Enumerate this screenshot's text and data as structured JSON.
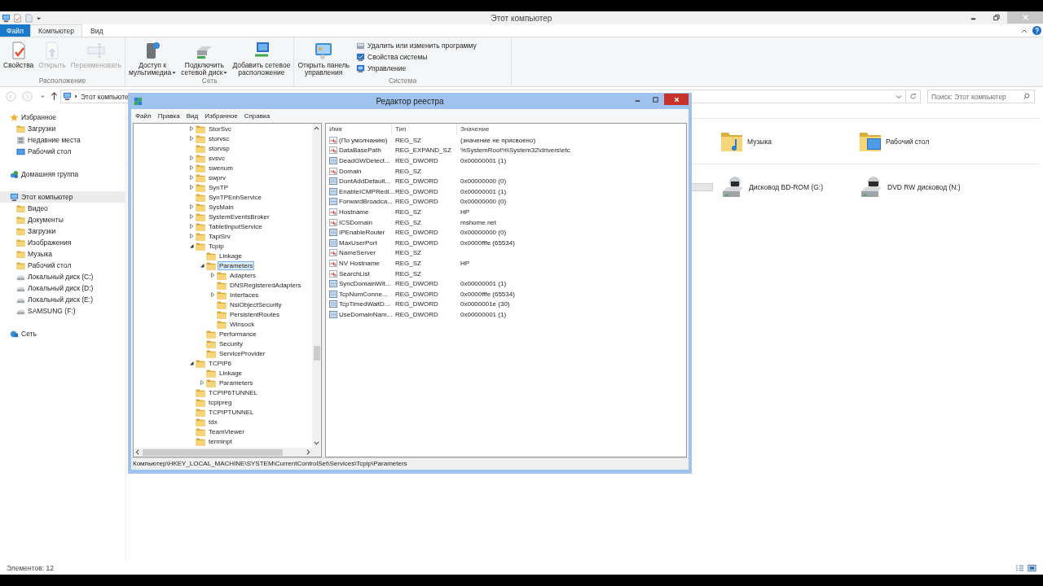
{
  "explorer": {
    "title": "Этот компьютер",
    "file_button": "Файл",
    "tabs": [
      {
        "label": "Компьютер",
        "selected": true
      },
      {
        "label": "Вид",
        "selected": false
      }
    ],
    "ribbon_groups": [
      {
        "label": "Расположение",
        "buttons": [
          {
            "label": "Свойства",
            "disabled": false,
            "dropdown": false
          },
          {
            "label": "Открыть",
            "disabled": true,
            "dropdown": false
          },
          {
            "label": "Переименовать",
            "disabled": true,
            "dropdown": false
          }
        ]
      },
      {
        "label": "Сеть",
        "buttons": [
          {
            "label": "Доступ к\nмультимедиа",
            "disabled": false,
            "dropdown": true
          },
          {
            "label": "Подключить\nсетевой диск",
            "disabled": false,
            "dropdown": true
          },
          {
            "label": "Добавить сетевое\nрасположение",
            "disabled": false,
            "dropdown": false
          }
        ]
      },
      {
        "label": "Система",
        "buttons": [
          {
            "label": "Открыть панель\nуправления",
            "disabled": false,
            "dropdown": false
          }
        ],
        "small_buttons": [
          "Удалить или изменить программу",
          "Свойства системы",
          "Управление"
        ]
      }
    ],
    "address": "Этот компьюте",
    "search": {
      "placeholder": "Поиск: Этот компьютер"
    },
    "nav": [
      {
        "label": "Избранное",
        "selected": false,
        "children": [
          {
            "label": "Загрузки",
            "selected": false
          },
          {
            "label": "Недавние места",
            "selected": false
          },
          {
            "label": "Рабочий стол",
            "selected": false
          }
        ]
      },
      {
        "label": "Домашняя группа",
        "selected": false
      },
      {
        "label": "Этот компьютер",
        "selected": true,
        "children": [
          {
            "label": "Видео",
            "selected": false
          },
          {
            "label": "Документы",
            "selected": false
          },
          {
            "label": "Загрузки",
            "selected": false
          },
          {
            "label": "Изображения",
            "selected": false
          },
          {
            "label": "Музыка",
            "selected": false
          },
          {
            "label": "Рабочий стол",
            "selected": false
          },
          {
            "label": "Локальный диск (C:)",
            "selected": false
          },
          {
            "label": "Локальный диск (D:)",
            "selected": false
          },
          {
            "label": "Локальный диск (E:)",
            "selected": false
          },
          {
            "label": "SAMSUNG (F:)",
            "selected": false
          }
        ]
      },
      {
        "label": "Сеть",
        "selected": false
      }
    ],
    "items": [
      {
        "label": "Музыка"
      },
      {
        "label": "Рабочий стол"
      },
      {
        "label": "Дисковод BD-ROM (G:)"
      },
      {
        "label": "DVD RW дисковод (N:)"
      }
    ],
    "status": "Элементов: 12"
  },
  "registry_editor": {
    "title": "Редактор реестра",
    "menu": [
      "Файл",
      "Правка",
      "Вид",
      "Избранное",
      "Справка"
    ],
    "tree": [
      {
        "name": "StorSvc",
        "expanded": false,
        "selected": false
      },
      {
        "name": "storvsc",
        "expanded": false,
        "selected": false
      },
      {
        "name": "storvsp",
        "selected": false
      },
      {
        "name": "svsvc",
        "expanded": false,
        "selected": false
      },
      {
        "name": "swenum",
        "expanded": false,
        "selected": false
      },
      {
        "name": "swprv",
        "expanded": false,
        "selected": false
      },
      {
        "name": "SynTP",
        "expanded": false,
        "selected": false
      },
      {
        "name": "SynTPEnhService",
        "selected": false
      },
      {
        "name": "SysMain",
        "expanded": false,
        "selected": false
      },
      {
        "name": "SystemEventsBroker",
        "expanded": false,
        "selected": false
      },
      {
        "name": "TabletInputService",
        "expanded": false,
        "selected": false
      },
      {
        "name": "TapiSrv",
        "expanded": false,
        "selected": false
      },
      {
        "name": "Tcpip",
        "expanded": true,
        "selected": false,
        "children": [
          {
            "name": "Linkage",
            "selected": false
          },
          {
            "name": "Parameters",
            "expanded": true,
            "selected": true,
            "children": [
              {
                "name": "Adapters",
                "expanded": false,
                "selected": false
              },
              {
                "name": "DNSRegisteredAdapters",
                "selected": false
              },
              {
                "name": "Interfaces",
                "expanded": false,
                "selected": false
              },
              {
                "name": "NsiObjectSecurity",
                "selected": false
              },
              {
                "name": "PersistentRoutes",
                "selected": false
              },
              {
                "name": "Winsock",
                "selected": false
              }
            ]
          },
          {
            "name": "Performance",
            "selected": false
          },
          {
            "name": "Security",
            "selected": false
          },
          {
            "name": "ServiceProvider",
            "selected": false
          }
        ]
      },
      {
        "name": "TCPIP6",
        "expanded": true,
        "selected": false,
        "children": [
          {
            "name": "Linkage",
            "selected": false
          },
          {
            "name": "Parameters",
            "expanded": false,
            "selected": false
          }
        ]
      },
      {
        "name": "TCPIP6TUNNEL",
        "selected": false
      },
      {
        "name": "tcpipreg",
        "selected": false
      },
      {
        "name": "TCPIPTUNNEL",
        "selected": false
      },
      {
        "name": "tdx",
        "selected": false
      },
      {
        "name": "TeamViewer",
        "selected": false
      },
      {
        "name": "terminpt",
        "selected": false
      }
    ],
    "columns": [
      "Имя",
      "Тип",
      "Значение"
    ],
    "values": [
      {
        "kind": "string",
        "name": "(По умолчанию)",
        "type": "REG_SZ",
        "data": "(значение не присвоено)"
      },
      {
        "kind": "string",
        "name": "DataBasePath",
        "type": "REG_EXPAND_SZ",
        "data": "%SystemRoot%\\System32\\drivers\\etc"
      },
      {
        "kind": "binary",
        "name": "DeadGWDetect...",
        "type": "REG_DWORD",
        "data": "0x00000001 (1)"
      },
      {
        "kind": "string",
        "name": "Domain",
        "type": "REG_SZ"
      },
      {
        "kind": "binary",
        "name": "DontAddDefault...",
        "type": "REG_DWORD",
        "data": "0x00000000 (0)"
      },
      {
        "kind": "binary",
        "name": "EnableICMPRedi...",
        "type": "REG_DWORD",
        "data": "0x00000001 (1)"
      },
      {
        "kind": "binary",
        "name": "ForwardBroadca...",
        "type": "REG_DWORD",
        "data": "0x00000000 (0)"
      },
      {
        "kind": "string",
        "name": "Hostname",
        "type": "REG_SZ",
        "data": "HP"
      },
      {
        "kind": "string",
        "name": "ICSDomain",
        "type": "REG_SZ",
        "data": "mshome.net"
      },
      {
        "kind": "binary",
        "name": "IPEnableRouter",
        "type": "REG_DWORD",
        "data": "0x00000000 (0)"
      },
      {
        "kind": "binary",
        "name": "MaxUserPort",
        "type": "REG_DWORD",
        "data": "0x0000fffe (65534)"
      },
      {
        "kind": "string",
        "name": "NameServer",
        "type": "REG_SZ"
      },
      {
        "kind": "string",
        "name": "NV Hostname",
        "type": "REG_SZ",
        "data": "HP"
      },
      {
        "kind": "string",
        "name": "SearchList",
        "type": "REG_SZ"
      },
      {
        "kind": "binary",
        "name": "SyncDomainWit...",
        "type": "REG_DWORD",
        "data": "0x00000001 (1)"
      },
      {
        "kind": "binary",
        "name": "TcpNumConne...",
        "type": "REG_DWORD",
        "data": "0x0000fffe (65534)"
      },
      {
        "kind": "binary",
        "name": "TcpTimedWaitD...",
        "type": "REG_DWORD",
        "data": "0x0000001e (30)"
      },
      {
        "kind": "binary",
        "name": "UseDomainNam...",
        "type": "REG_DWORD",
        "data": "0x00000001 (1)"
      }
    ],
    "status_bar": "Компьютер\\HKEY_LOCAL_MACHINE\\SYSTEM\\CurrentControlSet\\Services\\Tcpip\\Parameters"
  }
}
